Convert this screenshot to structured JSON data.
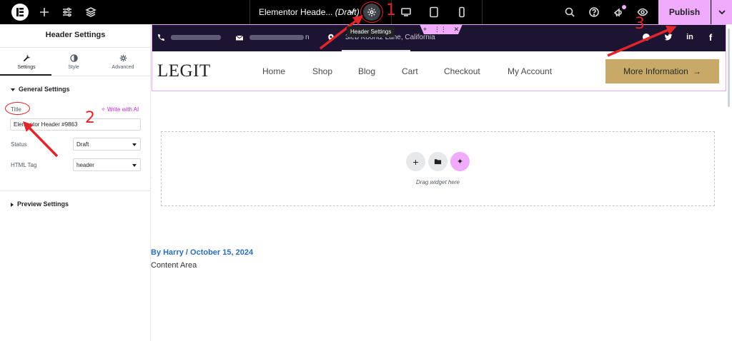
{
  "topbar": {
    "doc_title": "Elementor Heade...",
    "doc_status": "(Draft)",
    "tooltip": "Header Settings",
    "publish_label": "Publish",
    "icons": [
      "elementor-logo-icon",
      "add-icon",
      "sliders-icon",
      "layers-icon",
      "chevron-down-icon",
      "gear-icon",
      "desktop-icon",
      "tablet-icon",
      "mobile-icon",
      "search-icon",
      "help-icon",
      "notifications-icon",
      "preview-eye-icon",
      "chevron-down-icon"
    ]
  },
  "panel": {
    "title": "Header Settings",
    "tabs": [
      {
        "label": "Settings",
        "icon": "wrench-icon",
        "active": true
      },
      {
        "label": "Style",
        "icon": "contrast-icon",
        "active": false
      },
      {
        "label": "Advanced",
        "icon": "gear-icon",
        "active": false
      }
    ],
    "general_section": "General Settings",
    "title_label": "Title",
    "write_ai": "Write with AI",
    "title_value": "Elementor Header #9863",
    "status_label": "Status",
    "status_value": "Draft",
    "html_tag_label": "HTML Tag",
    "html_tag_value": "header",
    "preview_section": "Preview Settings"
  },
  "site": {
    "strip_address": "3ieb Koontz Lane, California",
    "email_suffix": "n",
    "brand": "LEGIT",
    "nav": [
      "Home",
      "Shop",
      "Blog",
      "Cart",
      "Checkout",
      "My Account"
    ],
    "cta": "More Information",
    "cta_arrow": "→"
  },
  "canvas": {
    "drag_hint": "Drag widget here",
    "meta": "By Harry / October 15, 2024",
    "content": "Content Area"
  },
  "annotations": [
    "1",
    "2",
    "3"
  ],
  "colors": {
    "accent_pink": "#f0abfc",
    "strip_bg": "#1c1431",
    "cta_gold": "#c8a968",
    "annotation_red": "#e0262b",
    "link_blue": "#2a6ebb"
  }
}
